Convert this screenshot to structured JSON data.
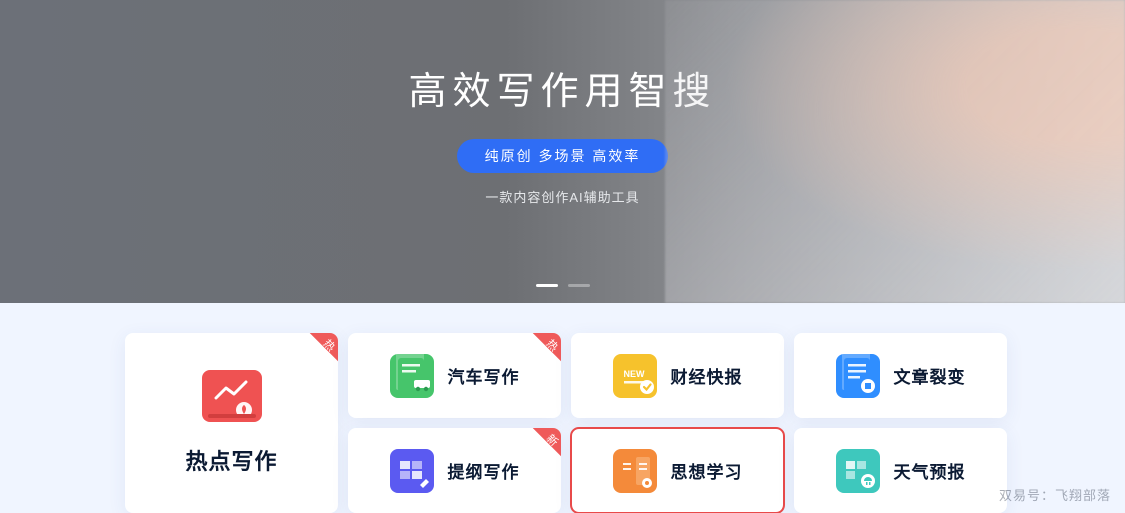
{
  "hero": {
    "title": "高效写作用智搜",
    "pill": "纯原创 多场景 高效率",
    "subtitle": "一款内容创作AI辅助工具"
  },
  "badges": {
    "hot": "热",
    "new": "新"
  },
  "cards": {
    "hotspot": "热点写作",
    "auto": "汽车写作",
    "finance": "财经快报",
    "split": "文章裂变",
    "outline": "提纲写作",
    "study": "思想学习",
    "weather": "天气预报"
  },
  "watermark": "双易号：飞翔部落",
  "colors": {
    "red": "#ef5252",
    "green": "#46c56b",
    "yellow": "#f6c22c",
    "blue": "#2f8eff",
    "purple": "#5b5af1",
    "orange": "#f48a3a",
    "teal": "#3ec8bd",
    "accent": "#2f6df5",
    "highlight": "#e84a4a"
  }
}
